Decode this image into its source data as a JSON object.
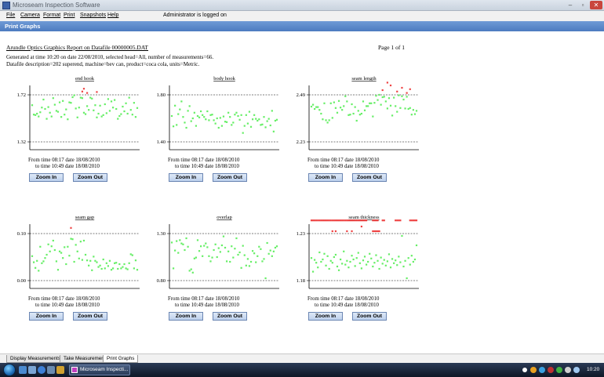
{
  "window": {
    "title": "Microseam Inspection Software",
    "min": "–",
    "max": "▫",
    "close": "✕"
  },
  "menu": {
    "items": [
      "File",
      "Camera",
      "Format",
      "Print",
      "Snapshots",
      "Help"
    ],
    "status": "Administrator is logged on"
  },
  "section_title": "Print Graphs",
  "report": {
    "title": "Arundle Optics Graphics Report on Datafile 00000005.DAT",
    "page": "Page 1 of 1",
    "generated": "Generated at time 10:20 on date 22/08/2010, selected head=All, number of measurements=66.",
    "description": "Datafile description=202 superend, machine=bev can, product=coca cola, units=Metric."
  },
  "charts_text": {
    "from_line": "From time 08:17 date 18/08/2010",
    "to_line": "to time 10:49 date 18/08/2010",
    "zoom_in": "Zoom In",
    "zoom_out": "Zoom Out"
  },
  "chart_data": [
    {
      "type": "scatter",
      "title": "end hook",
      "upper_label": "1.72",
      "lower_label": "1.32",
      "in_color": "#66ee66",
      "out_color": "#ee4444",
      "y": [
        0.22,
        0.42,
        0.43,
        0.4,
        0.46,
        0.37,
        0.27,
        0.1,
        0.3,
        0.51,
        0.26,
        0.38,
        0.46,
        0.07,
        0.21,
        0.34,
        0.36,
        0.16,
        0.47,
        0.13,
        0.42,
        0.31,
        0.52,
        0.16,
        0.17,
        0.05,
        0.01,
        0.29,
        0.48,
        0.27,
        0.06,
        0.07,
        0.38,
        0.41,
        0.24,
        0.32,
        0.06,
        0.08,
        0.33,
        0.22,
        0.48,
        0.4,
        0.23,
        0.46,
        0.43,
        0.2,
        0.39,
        0.09,
        0.34,
        0.14,
        0.27,
        0.11,
        0.3,
        0.51,
        0.45,
        0.41,
        0.25,
        0.35,
        0.18,
        0.4,
        0.06,
        0.32,
        0.42,
        0.17,
        0.47,
        0.28
      ],
      "outliers": [
        [
          31,
          -0.07
        ],
        [
          32,
          -0.13
        ],
        [
          34,
          -0.04
        ],
        [
          40,
          -0.06
        ]
      ]
    },
    {
      "type": "scatter",
      "title": "body hook",
      "upper_label": "1.80",
      "lower_label": "1.40",
      "in_color": "#66ee66",
      "out_color": "#ee4444",
      "y": [
        0.45,
        0.67,
        0.23,
        0.64,
        0.41,
        0.31,
        0.14,
        0.47,
        0.59,
        0.7,
        0.34,
        0.24,
        0.56,
        0.5,
        0.38,
        0.66,
        0.45,
        0.48,
        0.35,
        0.43,
        0.47,
        0.52,
        0.35,
        0.54,
        0.43,
        0.42,
        0.54,
        0.61,
        0.5,
        0.7,
        0.49,
        0.66,
        0.46,
        0.57,
        0.58,
        0.38,
        0.47,
        0.64,
        0.59,
        0.42,
        0.38,
        0.45,
        0.53,
        0.43,
        0.81,
        0.66,
        0.43,
        0.61,
        0.36,
        0.68,
        0.52,
        0.43,
        0.51,
        0.55,
        0.52,
        0.64,
        0.63,
        0.47,
        0.69,
        0.56,
        0.51,
        0.65,
        0.34,
        0.78,
        0.55,
        0.53
      ],
      "outliers": []
    },
    {
      "type": "scatter",
      "title": "seam length",
      "upper_label": "2.49",
      "lower_label": "2.23",
      "in_color": "#66ee66",
      "out_color": "#ee4444",
      "y": [
        0.25,
        0.21,
        0.3,
        0.26,
        0.26,
        0.32,
        0.4,
        0.52,
        0.18,
        0.54,
        0.59,
        0.54,
        0.18,
        0.49,
        0.16,
        0.28,
        0.38,
        0.13,
        0.27,
        0.32,
        0.24,
        0.03,
        0.14,
        0.43,
        0.42,
        0.2,
        0.4,
        0.26,
        0.55,
        0.34,
        0.42,
        0.4,
        0.14,
        0.33,
        0.24,
        0.24,
        0.18,
        0.18,
        0.46,
        0.17,
        0.02,
        0.11,
        0.0,
        0.21,
        0.05,
        0.04,
        0.14,
        0.29,
        0.07,
        0.23,
        0.44,
        0.06,
        0.24,
        0.36,
        0.01,
        0.28,
        0.03,
        0.1,
        0.29,
        0.04,
        0.3,
        0.28,
        0.42,
        0.32,
        0.41,
        0.34
      ],
      "outliers": [
        [
          44,
          -0.1
        ],
        [
          47,
          -0.26
        ],
        [
          49,
          -0.2
        ],
        [
          53,
          -0.07
        ],
        [
          56,
          -0.15
        ],
        [
          59,
          -0.04
        ],
        [
          61,
          -0.12
        ]
      ]
    },
    {
      "type": "scatter",
      "title": "seam gap",
      "upper_label": "0.10",
      "lower_label": "0.00",
      "in_color": "#66ee66",
      "out_color": "#ee4444",
      "y": [
        0.48,
        0.61,
        0.73,
        0.58,
        0.79,
        0.28,
        0.63,
        0.59,
        0.52,
        0.45,
        0.23,
        0.38,
        0.27,
        0.15,
        0.35,
        0.59,
        0.77,
        0.38,
        0.41,
        0.52,
        0.29,
        0.65,
        0.28,
        0.47,
        0.11,
        0.12,
        0.6,
        0.24,
        0.38,
        0.53,
        0.17,
        0.56,
        0.15,
        0.45,
        0.57,
        0.68,
        0.58,
        0.78,
        0.49,
        0.58,
        0.61,
        0.71,
        0.68,
        0.75,
        0.55,
        0.74,
        0.63,
        0.69,
        0.58,
        0.77,
        0.74,
        0.63,
        0.62,
        0.75,
        0.65,
        0.74,
        0.71,
        0.65,
        0.74,
        0.76,
        0.63,
        0.44,
        0.46,
        0.74,
        0.57,
        0.77
      ],
      "outliers": [
        [
          24,
          -0.12
        ]
      ]
    },
    {
      "type": "scatter",
      "title": "overlap",
      "upper_label": "1.30",
      "lower_label": "0.80",
      "in_color": "#66ee66",
      "out_color": "#ee4444",
      "y": [
        0.19,
        0.74,
        0.36,
        0.16,
        0.41,
        0.14,
        0.21,
        0.23,
        0.35,
        0.1,
        0.28,
        0.79,
        0.76,
        0.83,
        0.53,
        0.51,
        0.14,
        0.37,
        0.27,
        0.48,
        0.26,
        0.21,
        0.29,
        0.48,
        0.59,
        0.51,
        0.35,
        0.23,
        0.5,
        0.31,
        0.39,
        0.25,
        0.06,
        0.3,
        0.59,
        0.38,
        0.6,
        0.27,
        0.51,
        0.32,
        0.1,
        0.45,
        0.4,
        0.73,
        0.26,
        0.46,
        0.68,
        0.54,
        0.69,
        0.6,
        0.37,
        0.42,
        0.61,
        0.48,
        0.28,
        0.33,
        0.59,
        0.54,
        0.95,
        0.2,
        0.43,
        0.36,
        0.48,
        0.38,
        0.3,
        0.27
      ],
      "outliers": []
    },
    {
      "type": "scatter",
      "title": "seam thickness",
      "upper_label": "1.23",
      "lower_label": "1.18",
      "in_color": "#66ee66",
      "out_color": "#ee4444",
      "y": [
        0.52,
        0.81,
        0.56,
        0.62,
        0.72,
        0.4,
        0.6,
        0.55,
        0.43,
        0.68,
        0.48,
        0.75,
        0.58,
        0.62,
        0.5,
        0.45,
        0.7,
        0.78,
        0.55,
        0.64,
        0.38,
        0.66,
        0.58,
        0.72,
        0.6,
        0.47,
        0.55,
        0.69,
        0.52,
        0.41,
        0.63,
        0.74,
        0.57,
        0.49,
        0.66,
        0.6,
        0.43,
        0.53,
        0.7,
        0.62,
        0.46,
        0.58,
        0.75,
        0.51,
        0.64,
        0.56,
        0.68,
        0.59,
        0.44,
        0.72,
        0.54,
        0.63,
        0.57,
        0.67,
        0.49,
        0.61,
        0.05,
        0.7,
        0.58,
        0.95,
        0.52,
        0.66,
        0.47,
        0.6,
        0.55,
        0.25
      ],
      "outliers": [
        [
          0,
          -0.28
        ],
        [
          1,
          -0.28
        ],
        [
          2,
          -0.28
        ],
        [
          3,
          -0.28
        ],
        [
          4,
          -0.28
        ],
        [
          5,
          -0.28
        ],
        [
          6,
          -0.28
        ],
        [
          7,
          -0.28
        ],
        [
          8,
          -0.28
        ],
        [
          9,
          -0.28
        ],
        [
          10,
          -0.28
        ],
        [
          11,
          -0.28
        ],
        [
          12,
          -0.28
        ],
        [
          13,
          -0.28
        ],
        [
          14,
          -0.28
        ],
        [
          15,
          -0.28
        ],
        [
          16,
          -0.28
        ],
        [
          17,
          -0.28
        ],
        [
          18,
          -0.28
        ],
        [
          19,
          -0.28
        ],
        [
          20,
          -0.28
        ],
        [
          21,
          -0.28
        ],
        [
          22,
          -0.28
        ],
        [
          23,
          -0.28
        ],
        [
          24,
          -0.28
        ],
        [
          25,
          -0.28
        ],
        [
          26,
          -0.28
        ],
        [
          27,
          -0.28
        ],
        [
          28,
          -0.28
        ],
        [
          29,
          -0.28
        ],
        [
          30,
          -0.28
        ],
        [
          31,
          -0.28
        ],
        [
          32,
          -0.28
        ],
        [
          33,
          -0.28
        ],
        [
          34,
          -0.28
        ],
        [
          38,
          -0.28
        ],
        [
          39,
          -0.28
        ],
        [
          40,
          -0.28
        ],
        [
          41,
          -0.28
        ],
        [
          44,
          -0.28
        ],
        [
          45,
          -0.28
        ],
        [
          52,
          -0.28
        ],
        [
          53,
          -0.28
        ],
        [
          54,
          -0.28
        ],
        [
          55,
          -0.28
        ],
        [
          61,
          -0.28
        ],
        [
          62,
          -0.28
        ],
        [
          63,
          -0.28
        ],
        [
          64,
          -0.28
        ],
        [
          65,
          -0.28
        ],
        [
          13,
          -0.05
        ],
        [
          15,
          -0.05
        ],
        [
          22,
          -0.05
        ],
        [
          25,
          -0.05
        ],
        [
          38,
          -0.05
        ],
        [
          39,
          -0.05
        ],
        [
          40,
          -0.05
        ],
        [
          41,
          -0.05
        ],
        [
          31,
          -0.15
        ],
        [
          42,
          -0.05
        ]
      ]
    }
  ],
  "tabs": [
    "Display Measurements",
    "Take Measurements",
    "Print Graphs"
  ],
  "taskbar": {
    "app_label": "Microseam Inspecti...",
    "clock": "10:20"
  }
}
